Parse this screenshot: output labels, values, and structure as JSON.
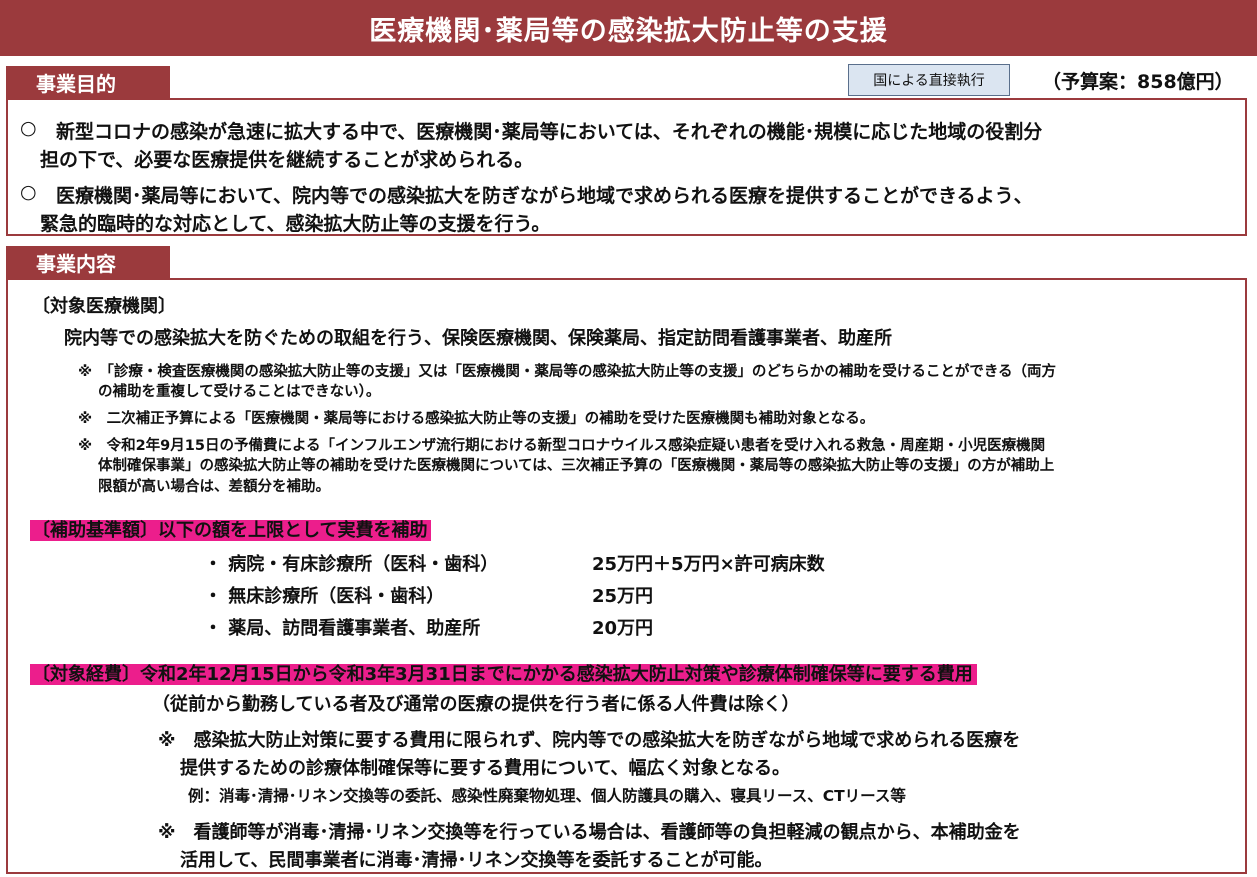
{
  "title": "医療機関･薬局等の感染拡大防止等の支援",
  "purpose": {
    "heading": "事業目的",
    "badge": "国による直接執行",
    "budget": "（予算案：858億円）",
    "items": [
      {
        "bullet": "○",
        "line1": "新型コロナの感染が急速に拡大する中で、医療機関･薬局等においては、それぞれの機能･規模に応じた地域の役割分",
        "line2": "担の下で、必要な医療提供を継続することが求められる。"
      },
      {
        "bullet": "○",
        "line1": "医療機関･薬局等において、院内等での感染拡大を防ぎながら地域で求められる医療を提供することができるよう、",
        "line2": "緊急的臨時的な対応として、感染拡大防止等の支援を行う。"
      }
    ]
  },
  "content": {
    "heading": "事業内容",
    "target": {
      "label": "〔対象医療機関〕",
      "text": "院内等での感染拡大を防ぐための取組を行う、保険医療機関、保険薬局、指定訪問看護事業者、助産所",
      "notes": [
        [
          "※　「診療・検査医療機関の感染拡大防止等の支援」又は「医療機関・薬局等の感染拡大防止等の支援」のどちらかの補助を受けることができる（両方",
          "の補助を重複して受けることはできない）。"
        ],
        [
          "※　二次補正予算による「医療機関・薬局等における感染拡大防止等の支援」の補助を受けた医療機関も補助対象となる。"
        ],
        [
          "※　令和2年9月15日の予備費による「インフルエンザ流行期における新型コロナウイルス感染症疑い患者を受け入れる救急・周産期・小児医療機関",
          "体制確保事業」の感染拡大防止等の補助を受けた医療機関については、三次補正予算の「医療機関・薬局等の感染拡大防止等の支援」の方が補助上",
          "限額が高い場合は、差額分を補助。"
        ]
      ]
    },
    "standard": {
      "label": "〔補助基準額〕以下の額を上限として実費を補助",
      "rows": [
        {
          "category": "・ 病院・有床診療所（医科・歯科）",
          "amount": "25万円＋5万円×許可病床数"
        },
        {
          "category": "・ 無床診療所（医科・歯科）",
          "amount": "25万円"
        },
        {
          "category": "・ 薬局、訪問看護事業者、助産所",
          "amount": "20万円"
        }
      ]
    },
    "expense": {
      "label": "〔対象経費〕令和2年12月15日から令和3年3月31日までにかかる感染拡大防止対策や診療体制確保等に要する費用",
      "sub": "（従前から勤務している者及び通常の医療の提供を行う者に係る人件費は除く）",
      "note1_line1": "※　感染拡大防止対策に要する費用に限られず、院内等での感染拡大を防ぎながら地域で求められる医療を",
      "note1_line2": "提供するための診療体制確保等に要する費用について、幅広く対象となる。",
      "example": "例：消毒･清掃･リネン交換等の委託、感染性廃棄物処理、個人防護具の購入、寝具リース、CTリース等",
      "note2_line1": "※　看護師等が消毒･清掃･リネン交換等を行っている場合は、看護師等の負担軽減の観点から、本補助金を",
      "note2_line2": "活用して、民間事業者に消毒･清掃･リネン交換等を委託することが可能。"
    }
  }
}
